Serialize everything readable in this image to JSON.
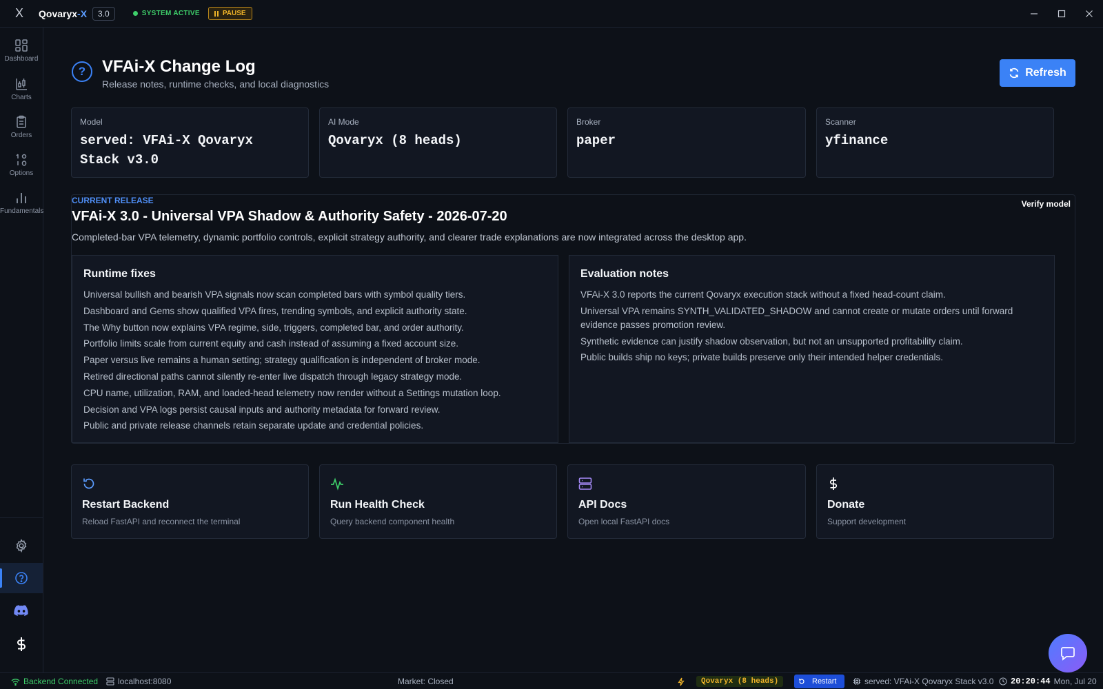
{
  "titlebar": {
    "logo": "X",
    "app_name_main": "Qovaryx",
    "app_name_accent": "-X",
    "version": "3.0",
    "status": "SYSTEM ACTIVE",
    "pause_label": "PAUSE",
    "minimize": "—",
    "maximize": "☐",
    "close": "✕"
  },
  "sidebar": {
    "items": [
      {
        "label": "Dashboard",
        "icon": "dashboard-icon"
      },
      {
        "label": "Charts",
        "icon": "charts-icon"
      },
      {
        "label": "Orders",
        "icon": "orders-icon"
      },
      {
        "label": "Options",
        "icon": "options-icon"
      },
      {
        "label": "Fundamentals",
        "icon": "fundamentals-icon"
      }
    ],
    "bottom": [
      {
        "icon": "gear-icon"
      },
      {
        "icon": "help-icon",
        "active": true
      },
      {
        "icon": "discord-icon"
      },
      {
        "icon": "dollar-icon"
      }
    ]
  },
  "header": {
    "title": "VFAi-X Change Log",
    "subtitle": "Release notes, runtime checks, and local diagnostics",
    "refresh_label": "Refresh"
  },
  "info_cards": [
    {
      "label": "Model",
      "value": "served: VFAi-X Qovaryx Stack v3.0"
    },
    {
      "label": "AI Mode",
      "value": "Qovaryx (8 heads)"
    },
    {
      "label": "Broker",
      "value": "paper"
    },
    {
      "label": "Scanner",
      "value": "yfinance"
    }
  ],
  "release": {
    "tag": "CURRENT RELEASE",
    "verify_label": "Verify model",
    "title": "VFAi-X 3.0 - Universal VPA Shadow & Authority Safety - 2026-07-20",
    "description": "Completed-bar VPA telemetry, dynamic portfolio controls, explicit strategy authority, and clearer trade explanations are now integrated across the desktop app.",
    "runtime_fixes": {
      "heading": "Runtime fixes",
      "items": [
        "Universal bullish and bearish VPA signals now scan completed bars with symbol quality tiers.",
        "Dashboard and Gems show qualified VPA fires, trending symbols, and explicit authority state.",
        "The Why button now explains VPA regime, side, triggers, completed bar, and order authority.",
        "Portfolio limits scale from current equity and cash instead of assuming a fixed account size.",
        "Paper versus live remains a human setting; strategy qualification is independent of broker mode.",
        "Retired directional paths cannot silently re-enter live dispatch through legacy strategy mode.",
        "CPU name, utilization, RAM, and loaded-head telemetry now render without a Settings mutation loop.",
        "Decision and VPA logs persist causal inputs and authority metadata for forward review.",
        "Public and private release channels retain separate update and credential policies."
      ]
    },
    "evaluation_notes": {
      "heading": "Evaluation notes",
      "items": [
        "VFAi-X 3.0 reports the current Qovaryx execution stack without a fixed head-count claim.",
        "Universal VPA remains SYNTH_VALIDATED_SHADOW and cannot create or mutate orders until forward evidence passes promotion review.",
        "Synthetic evidence can justify shadow observation, but not an unsupported profitability claim.",
        "Public builds ship no keys; private builds preserve only their intended helper credentials."
      ]
    }
  },
  "actions": [
    {
      "title": "Restart Backend",
      "subtitle": "Reload FastAPI and reconnect the terminal",
      "icon": "restart-icon",
      "color": "#5b9cff"
    },
    {
      "title": "Run Health Check",
      "subtitle": "Query backend component health",
      "icon": "activity-icon",
      "color": "#3ecf6a"
    },
    {
      "title": "API Docs",
      "subtitle": "Open local FastAPI docs",
      "icon": "server-icon",
      "color": "#a78bfa"
    },
    {
      "title": "Donate",
      "subtitle": "Support development",
      "icon": "dollar-icon",
      "color": "#ffffff"
    }
  ],
  "statusbar": {
    "connection": "Backend Connected",
    "host": "localhost:8080",
    "market": "Market: Closed",
    "mode_badge": "Qovaryx (8 heads)",
    "restart_label": "Restart",
    "served": "served: VFAi-X Qovaryx Stack v3.0",
    "time": "20:20:44",
    "date": "Mon, Jul 20"
  },
  "colors": {
    "accent": "#3b82f6",
    "success": "#3ecf6a",
    "warning": "#f0b429",
    "background": "#0d1118"
  }
}
